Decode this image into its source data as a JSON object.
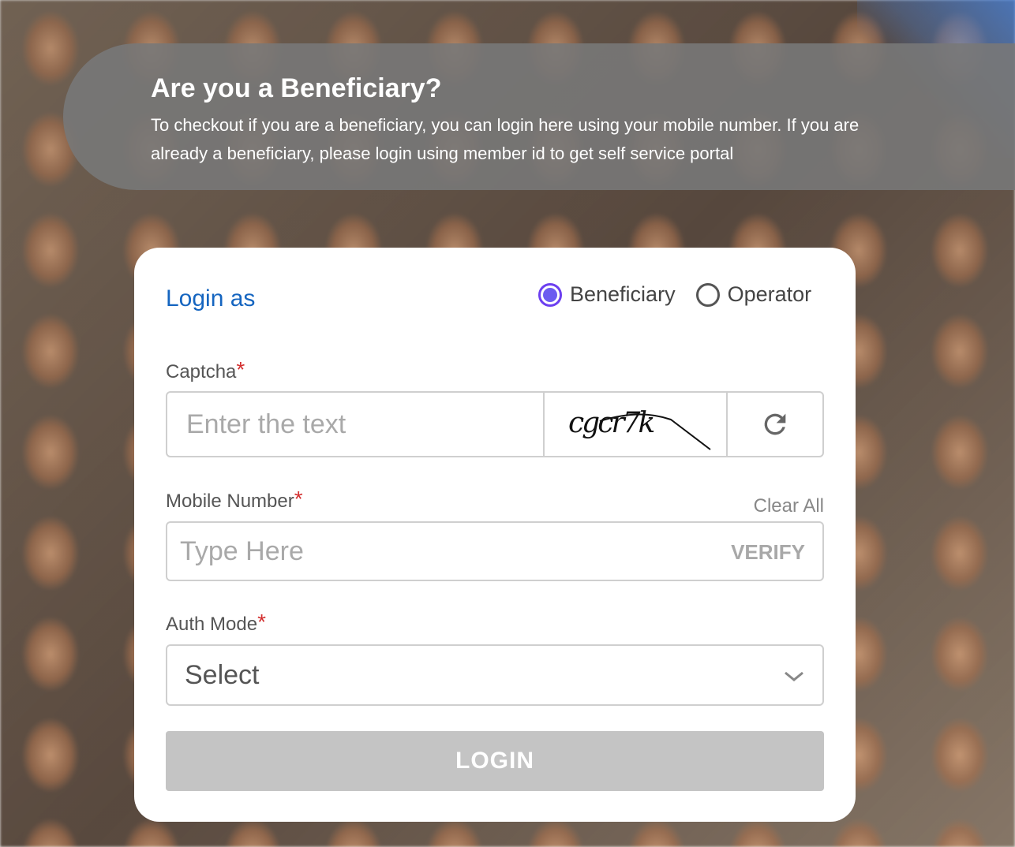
{
  "banner": {
    "title": "Are you a Beneficiary?",
    "description": "To checkout if you are a beneficiary, you can login here using your mobile number. If you are already a beneficiary, please login using member id to get self service portal"
  },
  "login": {
    "heading": "Login as",
    "options": [
      {
        "label": "Beneficiary",
        "selected": true
      },
      {
        "label": "Operator",
        "selected": false
      }
    ],
    "captcha": {
      "label": "Captcha",
      "required_mark": "*",
      "placeholder": "Enter the text",
      "image_text": "cgcr7k"
    },
    "mobile": {
      "label": "Mobile Number",
      "required_mark": "*",
      "placeholder": "Type Here",
      "clear_label": "Clear All",
      "verify_label": "VERIFY"
    },
    "auth_mode": {
      "label": "Auth Mode",
      "required_mark": "*",
      "selected": "Select"
    },
    "submit_label": "LOGIN"
  },
  "colors": {
    "accent_blue": "#1565c0",
    "radio_selected": "#6c5cf0",
    "required": "#d32f2f",
    "disabled_button": "#c4c4c4"
  },
  "icons": [
    "refresh-icon",
    "chevron-down-icon"
  ]
}
